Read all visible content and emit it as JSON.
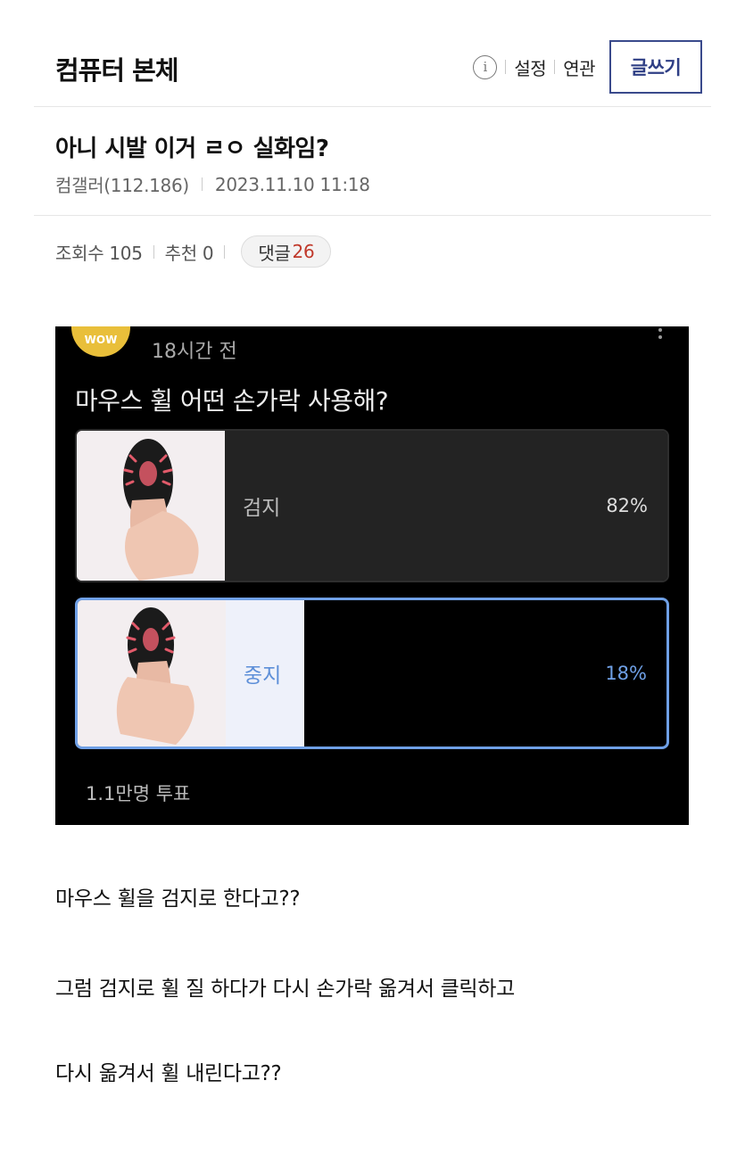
{
  "header": {
    "gallery_title": "컴퓨터 본체",
    "info_icon": "info-icon",
    "settings_label": "설정",
    "related_label": "연관",
    "write_button": "글쓰기"
  },
  "post": {
    "title": "아니 시발 이거 ㄹㅇ 실화임?",
    "author": "컴갤러(112.186)",
    "datetime": "2023.11.10 11:18",
    "views_label": "조회수 105",
    "recommend_label": "추천 0",
    "comments_label": "댓글",
    "comments_count": "26"
  },
  "poll": {
    "time": "18시간 전",
    "question": "마우스 휠 어떤 손가락 사용해?",
    "options": [
      {
        "label": "검지",
        "percent_text": "82%",
        "percent": 82,
        "selected": false
      },
      {
        "label": "중지",
        "percent_text": "18%",
        "percent": 18,
        "selected": true
      }
    ],
    "votes": "1.1만명 투표",
    "avatar_text": "WOW"
  },
  "body": {
    "paragraphs": [
      "마우스 휠을 검지로 한다고??",
      "그럼 검지로 휠 질 하다가 다시 손가락 옮겨서 클릭하고",
      "다시 옮겨서 휠 내린다고??"
    ]
  },
  "colors": {
    "accent_navy": "#2f3f85",
    "comment_count_red": "#c0392b",
    "poll_selected_blue": "#6fa0e6"
  }
}
